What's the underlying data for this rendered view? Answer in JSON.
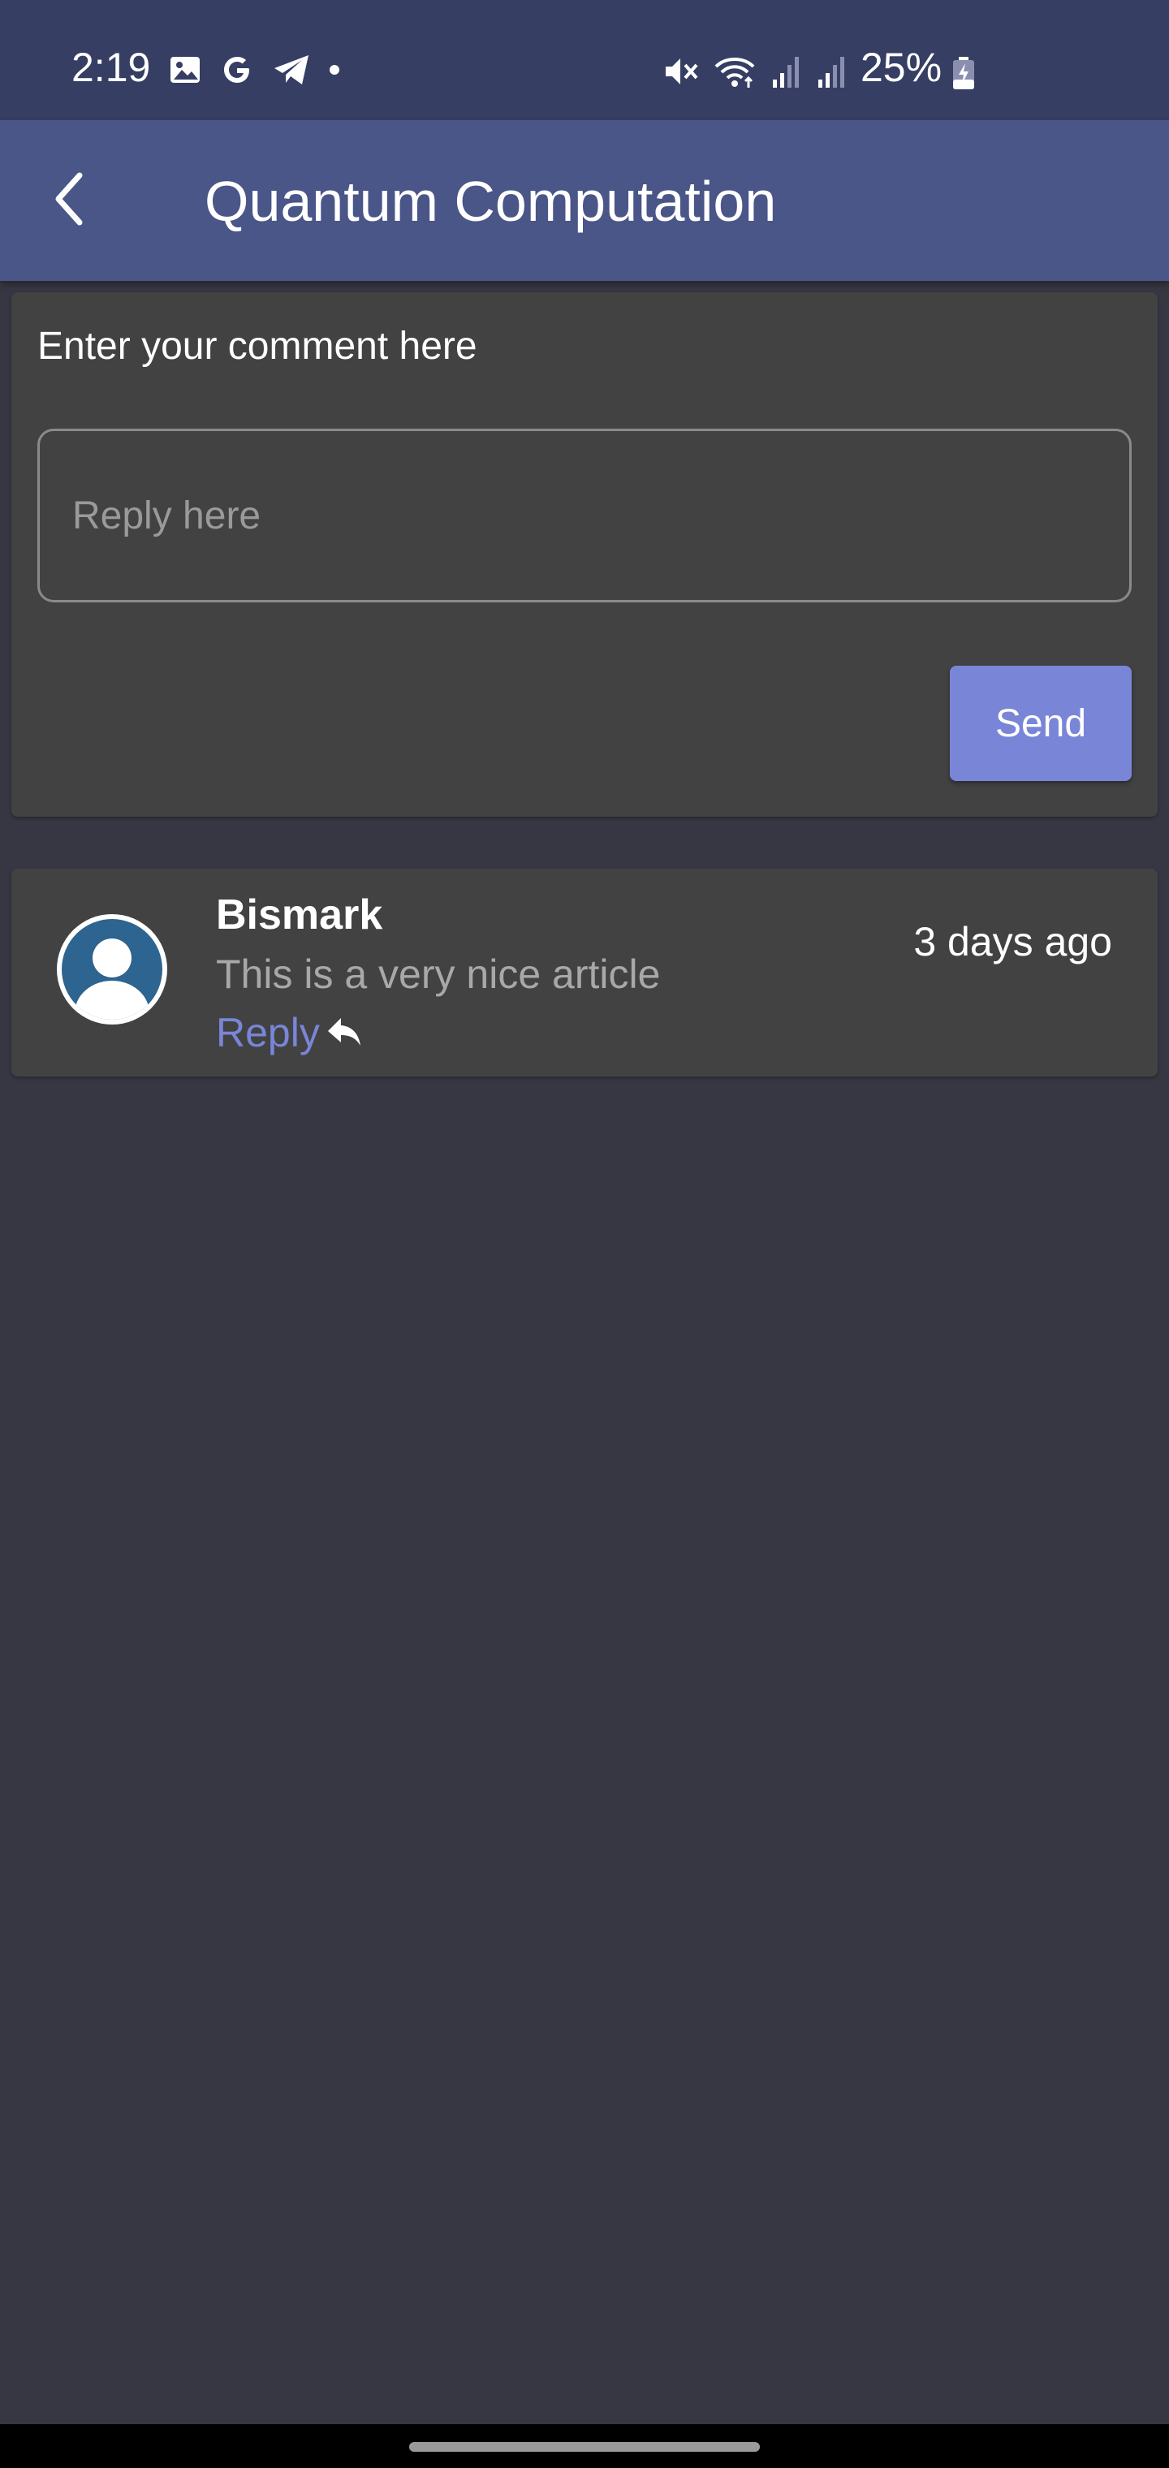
{
  "status_bar": {
    "time": "2:19",
    "battery_percent": "25%",
    "left_icons": [
      "gallery-icon",
      "google-icon",
      "telegram-icon",
      "dot-icon"
    ],
    "right_icons": [
      "mute-icon",
      "wifi-icon",
      "signal-icon",
      "signal-icon",
      "battery-charging-icon"
    ]
  },
  "app_bar": {
    "back_icon": "chevron-left-icon",
    "title": "Quantum Computation"
  },
  "comment_form": {
    "prompt": "Enter your comment here",
    "input_placeholder": "Reply here",
    "input_value": "",
    "send_label": "Send"
  },
  "comments": [
    {
      "author": "Bismark",
      "time": "3 days ago",
      "body": "This is a very nice article",
      "reply_label": "Reply",
      "avatar_icon": "user-avatar-icon"
    }
  ],
  "colors": {
    "status_bar": "#363e64",
    "app_bar": "#4a5588",
    "background": "#373743",
    "card": "#424242",
    "accent": "#7986d8",
    "avatar": "#2d6490"
  }
}
